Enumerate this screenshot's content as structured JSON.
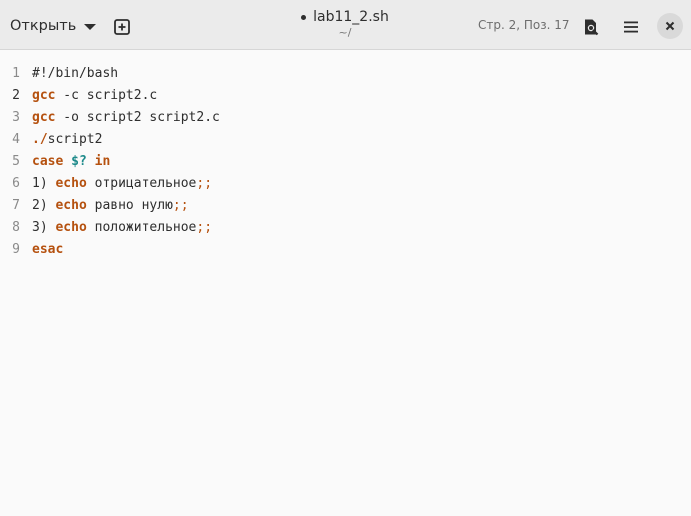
{
  "header": {
    "open_label": "Открыть",
    "title": "lab11_2.sh",
    "path": "~/",
    "cursor_position": "Стр. 2, Поз. 17"
  },
  "editor": {
    "current_line": 2,
    "lines": [
      {
        "number": "1",
        "segments": [
          {
            "text": "#!/bin/bash",
            "kind": "plain"
          }
        ]
      },
      {
        "number": "2",
        "segments": [
          {
            "text": "gcc",
            "kind": "kw"
          },
          {
            "text": " -c script2.c",
            "kind": "plain"
          }
        ]
      },
      {
        "number": "3",
        "segments": [
          {
            "text": "gcc",
            "kind": "kw"
          },
          {
            "text": " -o script2 script2.c",
            "kind": "plain"
          }
        ]
      },
      {
        "number": "4",
        "segments": [
          {
            "text": "./",
            "kind": "kw"
          },
          {
            "text": "script2",
            "kind": "plain"
          }
        ]
      },
      {
        "number": "5",
        "segments": [
          {
            "text": "case",
            "kind": "kw"
          },
          {
            "text": " ",
            "kind": "plain"
          },
          {
            "text": "$?",
            "kind": "var"
          },
          {
            "text": " ",
            "kind": "plain"
          },
          {
            "text": "in",
            "kind": "kw"
          }
        ]
      },
      {
        "number": "6",
        "segments": [
          {
            "text": "1) ",
            "kind": "plain"
          },
          {
            "text": "echo",
            "kind": "kw"
          },
          {
            "text": " отрицательное",
            "kind": "plain"
          },
          {
            "text": ";;",
            "kind": "op"
          }
        ]
      },
      {
        "number": "7",
        "segments": [
          {
            "text": "2) ",
            "kind": "plain"
          },
          {
            "text": "echo",
            "kind": "kw"
          },
          {
            "text": " равно нулю",
            "kind": "plain"
          },
          {
            "text": ";;",
            "kind": "op"
          }
        ]
      },
      {
        "number": "8",
        "segments": [
          {
            "text": "3) ",
            "kind": "plain"
          },
          {
            "text": "echo",
            "kind": "kw"
          },
          {
            "text": " положительное",
            "kind": "plain"
          },
          {
            "text": ";;",
            "kind": "op"
          }
        ]
      },
      {
        "number": "9",
        "segments": [
          {
            "text": "esac",
            "kind": "kw"
          }
        ]
      }
    ]
  },
  "icons": {
    "new_tab": "new-tab-icon",
    "search": "search-document-icon",
    "menu": "hamburger-menu-icon",
    "close": "close-icon"
  }
}
